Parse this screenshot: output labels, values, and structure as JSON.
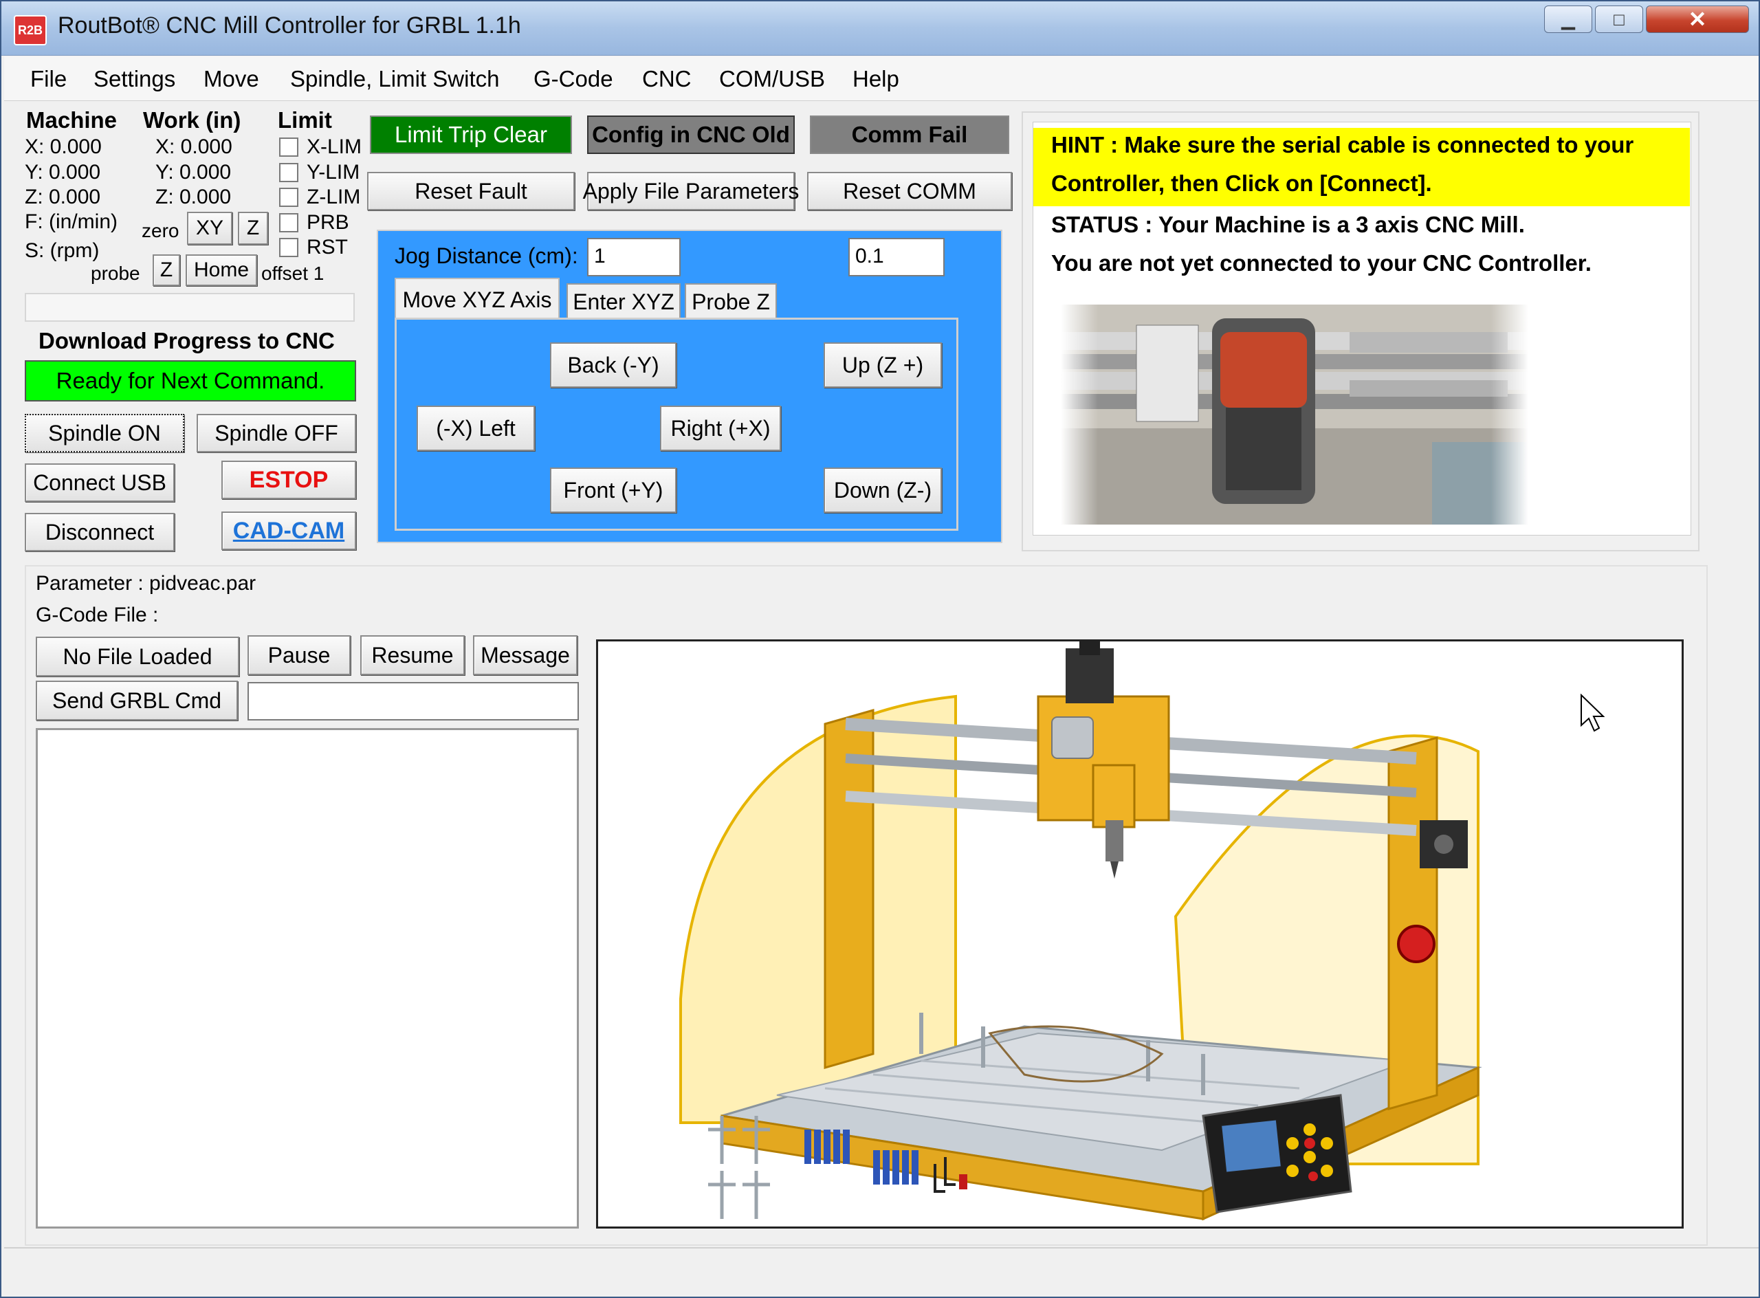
{
  "window": {
    "title": "RoutBot® CNC Mill Controller for GRBL 1.1h",
    "app_icon": "R2B",
    "min_glyph": "▁",
    "max_glyph": "□",
    "close_glyph": "✕"
  },
  "menu": [
    "File",
    "Settings",
    "Move",
    "Spindle, Limit Switch",
    "G-Code",
    "CNC",
    "COM/USB",
    "Help"
  ],
  "coords": {
    "machine_header": "Machine",
    "work_header": "Work (in)",
    "limit_header": "Limit",
    "machine": [
      "X: 0.000",
      "Y: 0.000",
      "Z: 0.000"
    ],
    "work": [
      "X: 0.000",
      "Y: 0.000",
      "Z: 0.000"
    ],
    "feed_label": "F: (in/min)",
    "speed_label": "S: (rpm)",
    "limits": [
      "X-LIM",
      "Y-LIM",
      "Z-LIM",
      "PRB",
      "RST"
    ],
    "zero_label": "zero",
    "zero_xy": "XY",
    "zero_z": "Z",
    "probe_label": "probe",
    "probe_z": "Z",
    "home": "Home",
    "offset_label": "offset 1"
  },
  "progress": {
    "title": "Download Progress to CNC",
    "status": "Ready for Next Command."
  },
  "controls": {
    "spindle_on": "Spindle ON",
    "spindle_off": "Spindle OFF",
    "connect_usb": "Connect USB",
    "estop": "ESTOP",
    "disconnect": "Disconnect",
    "cad_cam": "CAD-CAM"
  },
  "status_row": {
    "limit_trip": "Limit Trip Clear",
    "config": "Config in CNC Old",
    "comm": "Comm Fail",
    "reset_fault": "Reset Fault",
    "apply_params": "Apply File Parameters",
    "reset_comm": "Reset COMM"
  },
  "jog": {
    "distance_label": "Jog Distance (cm):",
    "distance_value": "1",
    "distance_z_value": "0.1",
    "tabs": [
      "Move XYZ Axis",
      "Enter XYZ",
      "Probe Z"
    ],
    "back": "Back  (-Y)",
    "up": "Up (Z +)",
    "left": "(-X) Left",
    "right": "Right  (+X)",
    "front": "Front  (+Y)",
    "down": "Down (Z-)"
  },
  "hint": {
    "line1": "HINT    : Make sure the serial cable is connected to your",
    "line2": "Controller, then Click on [Connect].",
    "line3": "STATUS : Your Machine is a 3 axis CNC Mill.",
    "line4": "You are not yet connected to your CNC Controller."
  },
  "files": {
    "parameter": "Parameter : pidveac.par",
    "gcode": "G-Code File :",
    "no_file": "No File Loaded",
    "pause": "Pause",
    "resume": "Resume",
    "message": "Message",
    "send_cmd": "Send GRBL Cmd",
    "cmd_value": ""
  },
  "colors": {
    "limit_trip_bg": "#008000",
    "config_bg": "#808080",
    "comm_bg": "#808080",
    "ready_bg": "#00ff00",
    "jog_bg": "#3399ff",
    "hint_bg": "#ffff00",
    "estop_fg": "#e81010",
    "cadcam_fg": "#1e73d8"
  },
  "icons": {
    "cursor": "mouse-cursor-icon"
  }
}
